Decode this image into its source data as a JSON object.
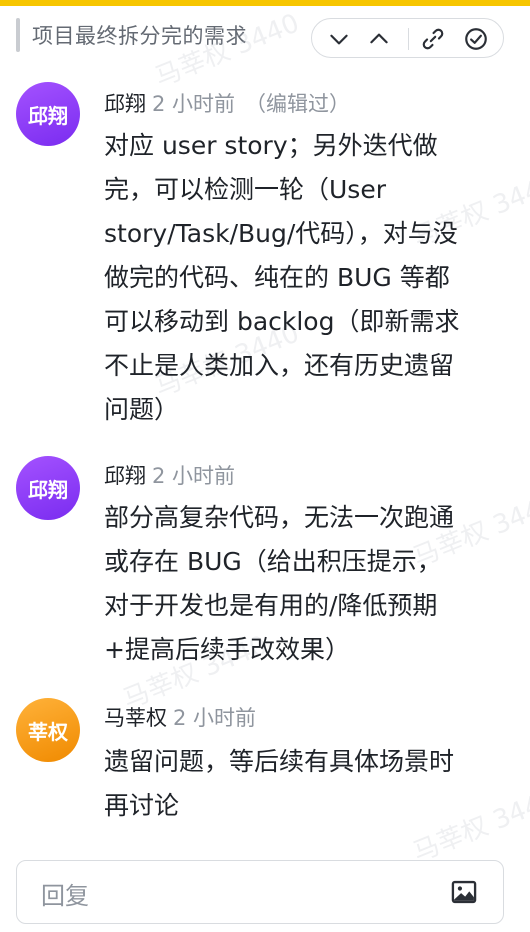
{
  "header": {
    "title": "项目最终拆分完的需求",
    "icons": [
      "chevron-down-icon",
      "chevron-up-icon",
      "link-icon",
      "check-circle-icon"
    ]
  },
  "watermark": {
    "text": "马莘权 3440"
  },
  "comments": [
    {
      "avatar_text": "邱翔",
      "author": "邱翔",
      "time": "2 小时前",
      "edited": "（编辑过）",
      "lines": [
        "对应 user story；另外迭代做",
        "完，可以检测一轮（User",
        "story/Task/Bug/代码），对与没",
        "做完的代码、纯在的 BUG 等都",
        "可以移动到 backlog（即新需求",
        "不止是人类加入，还有历史遗留",
        "问题）"
      ]
    },
    {
      "avatar_text": "邱翔",
      "author": "邱翔",
      "time": "2 小时前",
      "lines": [
        "部分高复杂代码，无法一次跑通",
        "或存在 BUG（给出积压提示，",
        "对于开发也是有用的/降低预期",
        "+提高后续手改效果）"
      ]
    },
    {
      "avatar_text": "莘权",
      "author": "马莘权",
      "time": "2 小时前",
      "lines": [
        "遗留问题，等后续有具体场景时",
        "再讨论"
      ]
    }
  ],
  "reply": {
    "placeholder": "回复",
    "icon": "image-icon"
  },
  "colors": {
    "accent_top": "#f7c600",
    "avatar_purple": "#8b3cf7",
    "avatar_orange": "#f59a0c",
    "muted_text": "#8f959e"
  }
}
